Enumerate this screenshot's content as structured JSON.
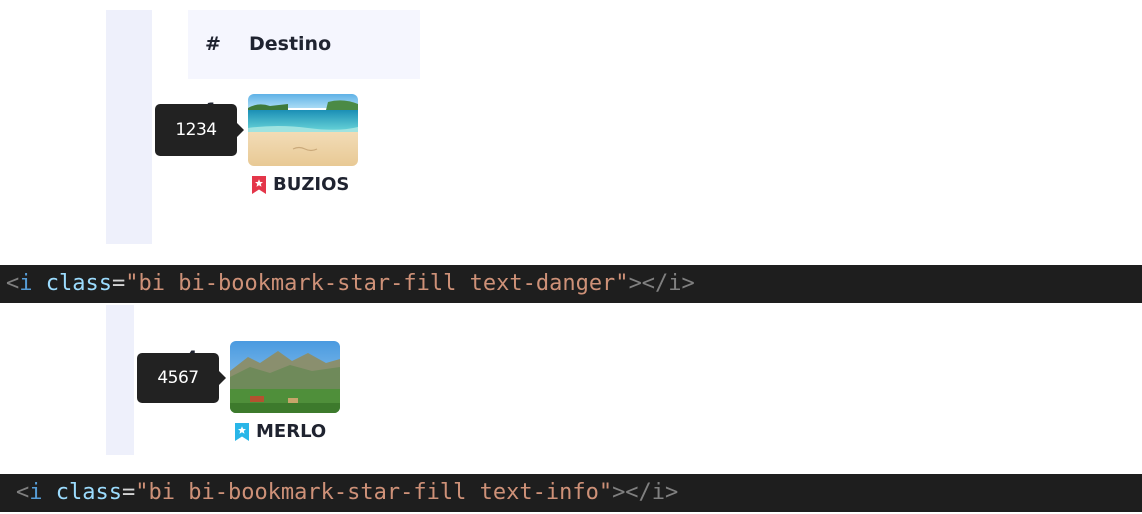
{
  "table": {
    "header": {
      "hash": "#",
      "destino": "Destino"
    },
    "rows": [
      {
        "number": "1",
        "tooltip": "1234",
        "name": "BUZIOS",
        "bookmark_color": "#e4364a"
      },
      {
        "number": "4",
        "tooltip": "4567",
        "name": "MERLO",
        "bookmark_color": "#29b6e8"
      }
    ]
  },
  "code": {
    "line1": {
      "lt": "<",
      "tag": "i",
      "attr": "class",
      "eq": "=",
      "value": "\"bi bi-bookmark-star-fill text-danger\"",
      "close": "></i>"
    },
    "line2": {
      "lt": "<",
      "tag": "i",
      "attr": "class",
      "eq": "=",
      "value": "\"bi bi-bookmark-star-fill text-info\"",
      "close": "></i>"
    }
  },
  "colors": {
    "danger": "#e4364a",
    "info": "#29b6e8",
    "code_bg": "#1e1e1e"
  }
}
